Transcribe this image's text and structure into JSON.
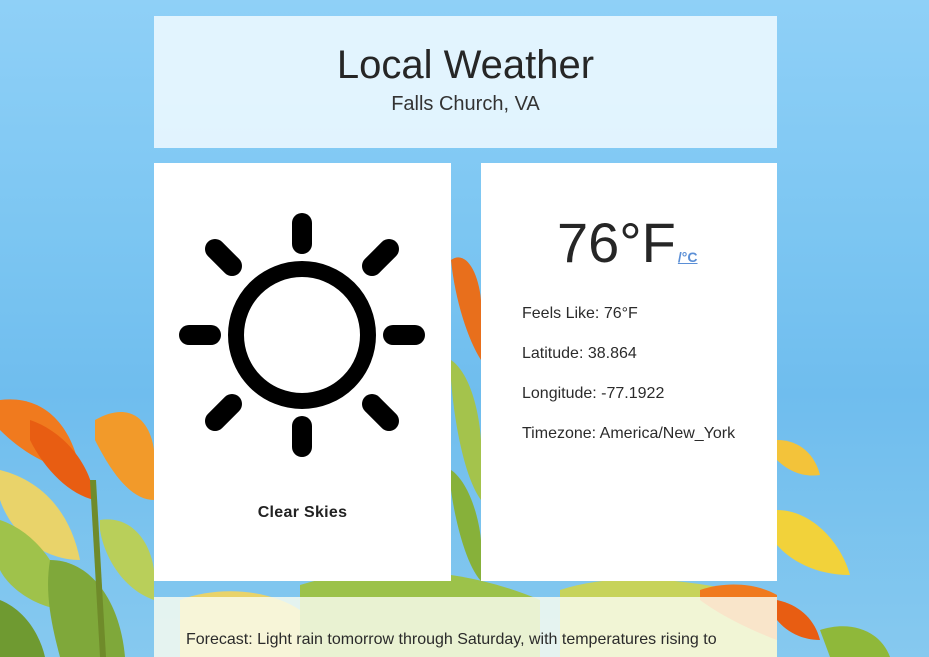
{
  "header": {
    "title": "Local Weather",
    "location": "Falls Church, VA"
  },
  "condition": {
    "icon": "sun-icon",
    "label": "Clear Skies"
  },
  "current": {
    "temperature": "76°F",
    "unit_toggle": "/°C",
    "feels_like": "Feels Like: 76°F",
    "latitude": "Latitude: 38.864",
    "longitude": "Longitude: -77.1922",
    "timezone": "Timezone: America/New_York"
  },
  "forecast": {
    "text": "Forecast: Light rain tomorrow through Saturday, with temperatures rising to"
  },
  "colors": {
    "sky": "#7cc6f2",
    "link": "#5b8fd6",
    "leaf_orange": "#f07a1e",
    "leaf_green": "#8fb83a"
  }
}
